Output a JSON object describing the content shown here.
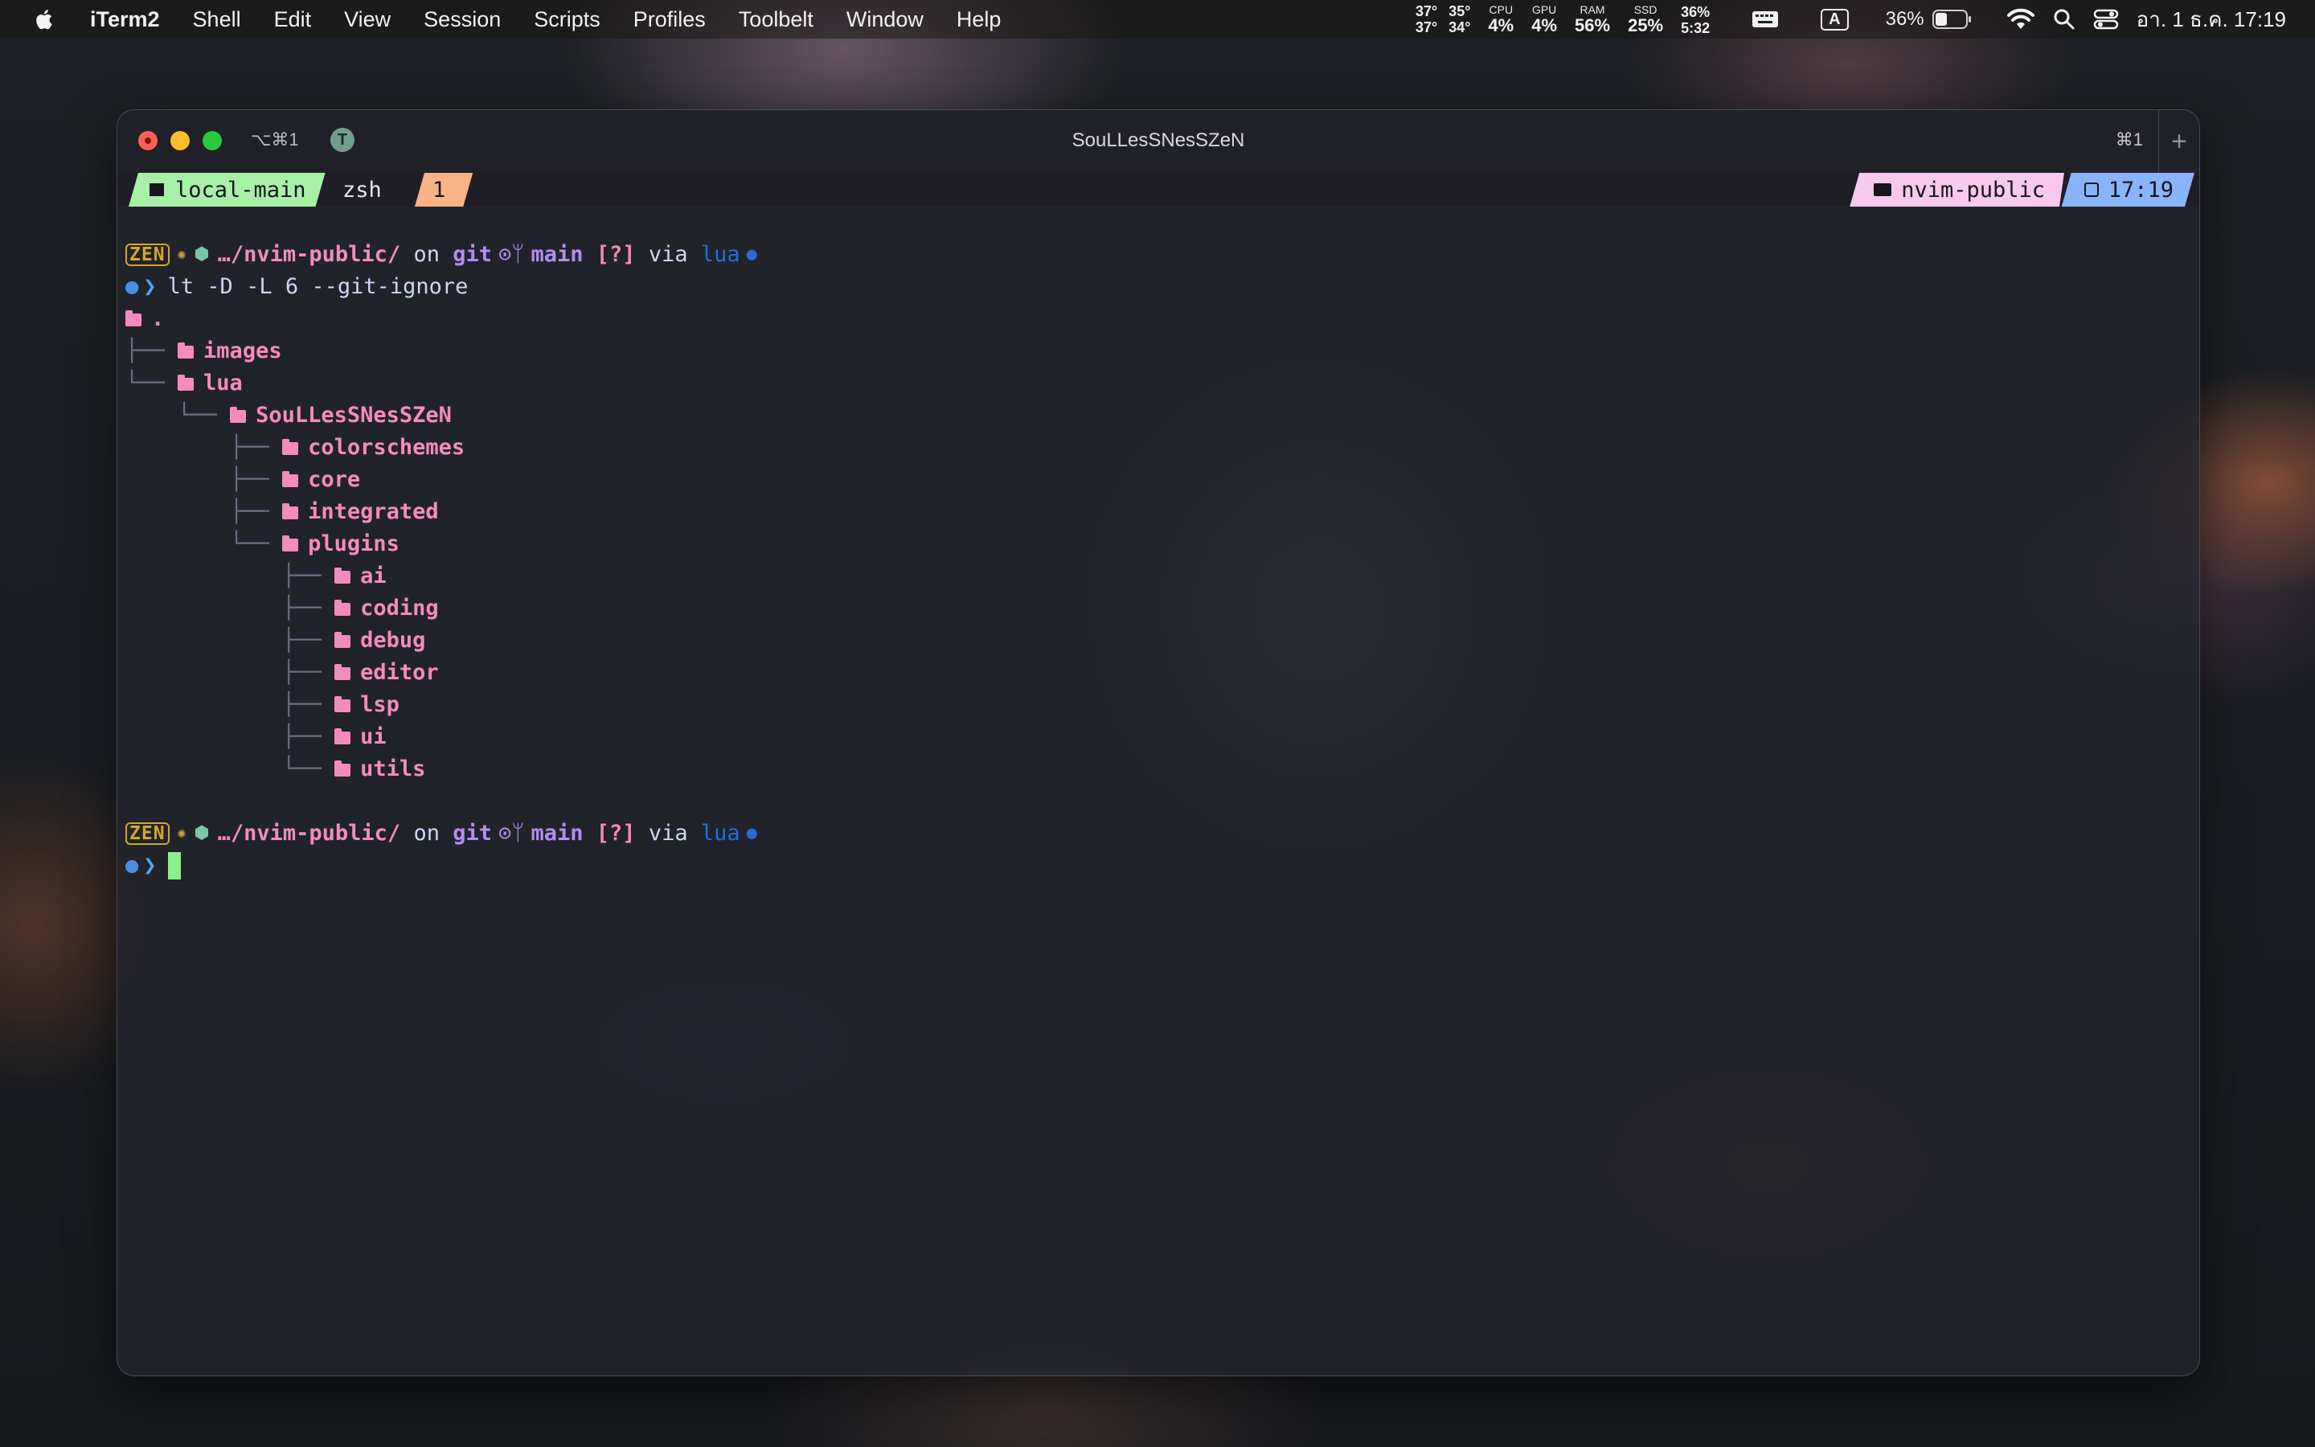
{
  "menubar": {
    "app_name": "iTerm2",
    "menus": [
      "Shell",
      "Edit",
      "View",
      "Session",
      "Scripts",
      "Profiles",
      "Toolbelt",
      "Window",
      "Help"
    ],
    "temps": {
      "a": "37°",
      "b": "35°",
      "c": "37°",
      "d": "34°"
    },
    "cpu": {
      "label": "CPU",
      "value": "4%"
    },
    "gpu": {
      "label": "GPU",
      "value": "4%"
    },
    "ram": {
      "label": "RAM",
      "value": "56%"
    },
    "ssd": {
      "label": "SSD",
      "value": "25%"
    },
    "battery_stat": {
      "top": "36%",
      "bottom": "5:32"
    },
    "input_source": "A",
    "battery": {
      "percent_text": "36%",
      "level": 0.36
    },
    "clock": "อา. 1 ธ.ค.  17:19",
    "icons": [
      "apple-logo-icon",
      "keyboard-icon",
      "battery-icon",
      "wifi-icon",
      "search-icon",
      "control-center-icon"
    ]
  },
  "window": {
    "title": "SouLLesSNesSZeN",
    "shortcut_left": "⌥⌘1",
    "shortcut_right": "⌘1",
    "tab_badge": "T",
    "new_tab": "+"
  },
  "status": {
    "session": "local-main",
    "window_name": "zsh",
    "pane": "1",
    "dir": "nvim-public",
    "time": "17:19"
  },
  "prompt": {
    "zen": "ZEN",
    "path": "…/nvim-public/",
    "on": "on",
    "git": "git",
    "branch": "main",
    "status": "[?]",
    "via": "via",
    "lang": "lua",
    "chevron": "❯"
  },
  "command": "lt -D -L 6 --git-ignore",
  "tree": [
    {
      "prefix": "",
      "name": "."
    },
    {
      "prefix": "├──",
      "name": "images"
    },
    {
      "prefix": "└──",
      "name": "lua"
    },
    {
      "prefix": "    └──",
      "name": "SouLLesSNesSZeN"
    },
    {
      "prefix": "        ├──",
      "name": "colorschemes"
    },
    {
      "prefix": "        ├──",
      "name": "core"
    },
    {
      "prefix": "        ├──",
      "name": "integrated"
    },
    {
      "prefix": "        └──",
      "name": "plugins"
    },
    {
      "prefix": "            ├──",
      "name": "ai"
    },
    {
      "prefix": "            ├──",
      "name": "coding"
    },
    {
      "prefix": "            ├──",
      "name": "debug"
    },
    {
      "prefix": "            ├──",
      "name": "editor"
    },
    {
      "prefix": "            ├──",
      "name": "lsp"
    },
    {
      "prefix": "            ├──",
      "name": "ui"
    },
    {
      "prefix": "            └──",
      "name": "utils"
    }
  ],
  "colors": {
    "accent_green": "#a7f0a6",
    "accent_orange": "#fab387",
    "accent_pink": "#f8c9ee",
    "accent_blue": "#89b4fa",
    "folder_pink": "#f58bbd"
  }
}
